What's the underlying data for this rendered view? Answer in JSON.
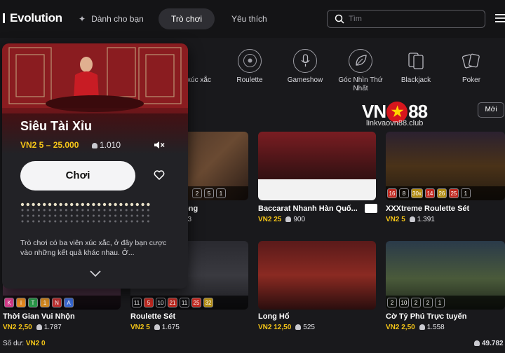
{
  "brand": {
    "name": "Evolution"
  },
  "nav": {
    "for_you": "Dành cho bạn",
    "games": "Trò chơi",
    "favorites": "Yêu thích"
  },
  "search": {
    "placeholder": "Tìm"
  },
  "categories": [
    {
      "label": "xúc xắc",
      "icon": "dice-icon"
    },
    {
      "label": "Roulette",
      "icon": "roulette-icon"
    },
    {
      "label": "Gameshow",
      "icon": "microphone-icon"
    },
    {
      "label": "Góc Nhìn Thứ Nhất",
      "icon": "first-person-icon"
    },
    {
      "label": "Blackjack",
      "icon": "cards-icon"
    },
    {
      "label": "Poker",
      "icon": "poker-cards-icon"
    }
  ],
  "watermark": {
    "brand_left": "VN",
    "brand_star": "★",
    "brand_right": "88",
    "url": "linkvaovn88.club"
  },
  "new_button": "Mới",
  "popup": {
    "title": "Siêu Tài Xỉu",
    "stake": "VN2 5 – 25.000",
    "players": "1.010",
    "play_label": "Chơi",
    "description": "Trò chơi có ba viên xúc xắc, ở đây bạn cược vào những kết quả khác nhau. Ở..."
  },
  "tiles": [
    {
      "title": "ộng",
      "stake": "",
      "players": "73",
      "chips": [
        "2",
        "5",
        "1"
      ]
    },
    {
      "title": "Baccarat Nhanh Hàn Quố...",
      "stake": "VN2 25",
      "players": "900",
      "chips": []
    },
    {
      "title": "XXXtreme Roulette Sét",
      "stake": "VN2 5",
      "players": "1.391",
      "chips": [
        "16",
        "8",
        "30x",
        "14",
        "26",
        "25",
        "1"
      ]
    },
    {
      "title": "Thời Gian Vui Nhộn",
      "stake": "VN2 2,50",
      "players": "1.787",
      "chips": [
        "K",
        "I",
        "T",
        "1",
        "N",
        "A"
      ]
    },
    {
      "title": "Roulette Sét",
      "stake": "VN2 5",
      "players": "1.675",
      "chips": [
        "11",
        "5",
        "10",
        "21",
        "11",
        "25",
        "32"
      ]
    },
    {
      "title": "Long Hổ",
      "stake": "VN2 12,50",
      "players": "525",
      "chips": []
    },
    {
      "title": "Cờ Tỷ Phú Trực tuyến",
      "stake": "VN2 2,50",
      "players": "1.558",
      "chips": [
        "2",
        "10",
        "2",
        "2",
        "1"
      ]
    }
  ],
  "footer": {
    "balance_label": "Số dư:",
    "balance_value": "VN2 0",
    "online": "49.782"
  },
  "colors": {
    "accent": "#f5c518",
    "background": "#19191c",
    "play_button": "#f4f4f6"
  }
}
